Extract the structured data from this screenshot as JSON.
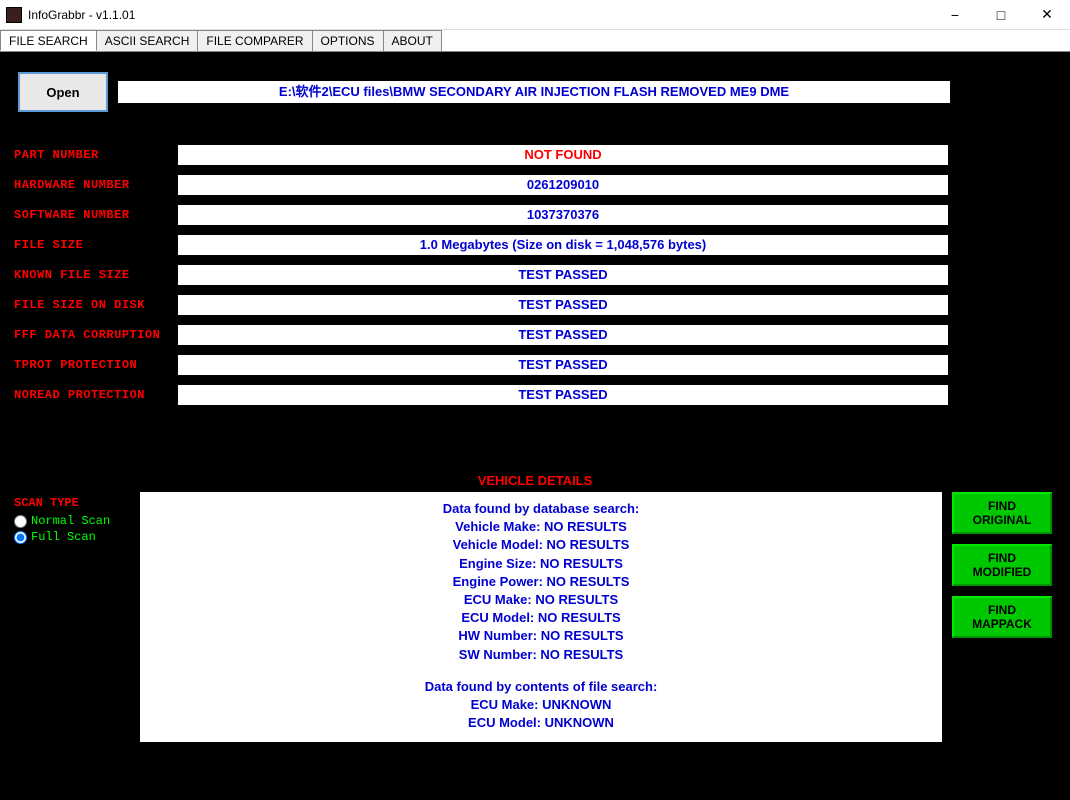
{
  "window": {
    "title": "InfoGrabbr - v1.1.01"
  },
  "tabs": {
    "file_search": "FILE SEARCH",
    "ascii_search": "ASCII SEARCH",
    "file_comparer": "FILE COMPARER",
    "options": "OPTIONS",
    "about": "ABOUT"
  },
  "open_button": "Open",
  "file_path": "E:\\软件2\\ECU files\\BMW SECONDARY AIR INJECTION FLASH REMOVED ME9 DME",
  "info": {
    "part_number": {
      "label": "PART NUMBER",
      "value": "NOT FOUND",
      "color": "red"
    },
    "hardware_number": {
      "label": "HARDWARE NUMBER",
      "value": "0261209010",
      "color": "blue"
    },
    "software_number": {
      "label": "SOFTWARE NUMBER",
      "value": "1037370376",
      "color": "blue"
    },
    "file_size": {
      "label": "FILE SIZE",
      "value": "1.0 Megabytes (Size on disk = 1,048,576 bytes)",
      "color": "blue"
    },
    "known_file_size": {
      "label": "KNOWN FILE SIZE",
      "value": "TEST PASSED",
      "color": "blue"
    },
    "file_size_on_disk": {
      "label": "FILE SIZE ON DISK",
      "value": "TEST PASSED",
      "color": "blue"
    },
    "fff_data_corruption": {
      "label": "FFF DATA CORRUPTION",
      "value": "TEST PASSED",
      "color": "blue"
    },
    "tprot_protection": {
      "label": "TPROT PROTECTION",
      "value": "TEST PASSED",
      "color": "blue"
    },
    "noread_protection": {
      "label": "NOREAD PROTECTION",
      "value": "TEST PASSED",
      "color": "blue"
    }
  },
  "vehicle_header": "VEHICLE DETAILS",
  "scan": {
    "title": "SCAN TYPE",
    "normal": "Normal Scan",
    "full": "Full Scan"
  },
  "details": {
    "db_header": "Data found by database search:",
    "vehicle_make": "Vehicle Make: NO RESULTS",
    "vehicle_model": "Vehicle Model: NO RESULTS",
    "engine_size": "Engine Size: NO RESULTS",
    "engine_power": "Engine Power: NO RESULTS",
    "ecu_make": "ECU Make: NO RESULTS",
    "ecu_model": "ECU Model: NO RESULTS",
    "hw_number": "HW Number: NO RESULTS",
    "sw_number": "SW Number: NO RESULTS",
    "file_header": "Data found by contents of file search:",
    "file_ecu_make": "ECU Make: UNKNOWN",
    "file_ecu_model": "ECU Model: UNKNOWN"
  },
  "actions": {
    "find_original": "FIND ORIGINAL",
    "find_modified": "FIND MODIFIED",
    "find_mappack": "FIND MAPPACK"
  }
}
